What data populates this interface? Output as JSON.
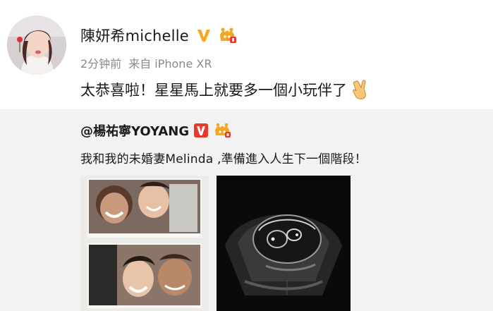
{
  "post": {
    "username": "陳妍希michelle",
    "time": "2分钟前",
    "source": "来自 iPhone XR",
    "text": "太恭喜啦！星星馬上就要多一個小玩伴了"
  },
  "repost": {
    "username": "@楊祐寧YOYANG",
    "text": "我和我的未婚妻Melinda ,準備進入人生下一個階段！"
  },
  "colors": {
    "verified_orange": "#f5a623",
    "repost_background": "#f2f2f2",
    "meta_gray": "#8a8a8a",
    "vip_red": "#e8392b"
  },
  "icons": {
    "verified": "orange-v-icon",
    "member": "crown-icon",
    "emoji": "victory-hand-icon"
  }
}
